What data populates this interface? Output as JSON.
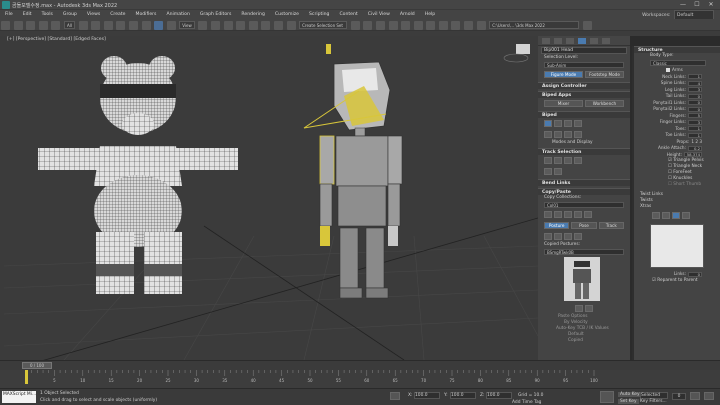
{
  "window": {
    "title": "곰돌모델수정.max - Autodesk 3ds Max 2022",
    "controls": [
      "—",
      "☐",
      "✕"
    ]
  },
  "menu": {
    "items": [
      "File",
      "Edit",
      "Tools",
      "Group",
      "Views",
      "Create",
      "Modifiers",
      "Animation",
      "Graph Editors",
      "Rendering",
      "Customize",
      "Scripting",
      "Content",
      "Civil View",
      "Arnold",
      "Help"
    ],
    "signin": "Sign In",
    "workspaces_label": "Workspaces:",
    "workspace_value": "Default"
  },
  "toolbar": {
    "filter": "All",
    "view": "View",
    "selection_set": "Create Selection Set",
    "path": "C:\\Users\\... \\3ds Max 2022"
  },
  "viewport": {
    "label": "[+] [Perspective] [Standard] [Edged Faces]"
  },
  "command_panel": {
    "object_name": "Bip001 Head",
    "selection_level_label": "Selection Level:",
    "sub_anim": "Sub-Anim",
    "figure_mode": "Figure Mode",
    "footstep_mode": "Footstep Mode",
    "assign_controller": "Assign Controller",
    "biped_apps": "Biped Apps",
    "mixer": "Mixer",
    "workbench": "Workbench",
    "biped": "Biped",
    "modes_display": "Modes and Display",
    "track_selection": "Track Selection",
    "bend_links": "Bend Links",
    "copy_paste": "Copy/Paste",
    "copy_collections": "Copy Collections:",
    "collection_value": "Col01",
    "posture": "Posture",
    "pose": "Pose",
    "track": "Track",
    "copied_postures": "Copied Postures:",
    "posture_value": "BSmgRTwk0B",
    "paste_options": "Paste Options",
    "by_velocity": "By Velocity",
    "auto_key_tcb": "Auto-Key TCB / IK Values",
    "default_opt": "Default",
    "copied_opt": "Copied"
  },
  "structure_panel": {
    "title": "Structure",
    "body_type_label": "Body Type:",
    "body_type": "Classic",
    "arms_label": "Arms",
    "rows": [
      {
        "label": "Neck Links:",
        "value": "1"
      },
      {
        "label": "Spine Links:",
        "value": "4"
      },
      {
        "label": "Leg Links:",
        "value": "3"
      },
      {
        "label": "Tail Links:",
        "value": "0"
      },
      {
        "label": "Ponytail1 Links:",
        "value": "0"
      },
      {
        "label": "Ponytail2 Links:",
        "value": "0"
      },
      {
        "label": "Fingers:",
        "value": "5"
      },
      {
        "label": "Finger Links:",
        "value": "3"
      },
      {
        "label": "Toes:",
        "value": "1"
      },
      {
        "label": "Toe Links:",
        "value": "1"
      }
    ],
    "props_label": "Props:",
    "props_value": "1   2   3",
    "ankle_label": "Ankle Attach:",
    "ankle_value": "0.2",
    "height_label": "Height:",
    "height_value": "58.374",
    "triangle_pelvis": "Triangle Pelvis",
    "triangle_neck": "Triangle Neck",
    "forefeet": "ForeFeet",
    "knuckles": "Knuckles",
    "short_thumb": "Short Thumb",
    "twist_links": "Twist Links",
    "twists": "Twists",
    "xtras": "Xtras",
    "links_label": "Links:",
    "links_value": "0",
    "reparent": "Reparent to Parent"
  },
  "timeline": {
    "position": "0 / 100",
    "ticks": [
      "0",
      "5",
      "10",
      "15",
      "20",
      "25",
      "30",
      "35",
      "40",
      "45",
      "50",
      "55",
      "60",
      "65",
      "70",
      "75",
      "80",
      "85",
      "90",
      "95",
      "100"
    ]
  },
  "status": {
    "maxscript": "MAXScript Mi...",
    "selected": "1 Object Selected",
    "prompt": "Click and drag to select and scale objects (uniformly)",
    "x_label": "X:",
    "x_value": "100.0",
    "y_label": "Y:",
    "y_value": "100.0",
    "z_label": "Z:",
    "z_value": "100.0",
    "grid": "Grid = 10.0",
    "add_time_tag": "Add Time Tag",
    "auto_key": "Auto Key",
    "selected_mode": "Selected",
    "set_key": "Set Key",
    "key_filters": "Key Filters...",
    "frame": "0"
  },
  "colors": {
    "accent": "#4a7bb0",
    "selection_yellow": "#d8c63a",
    "wire": "#2c2c2c"
  }
}
